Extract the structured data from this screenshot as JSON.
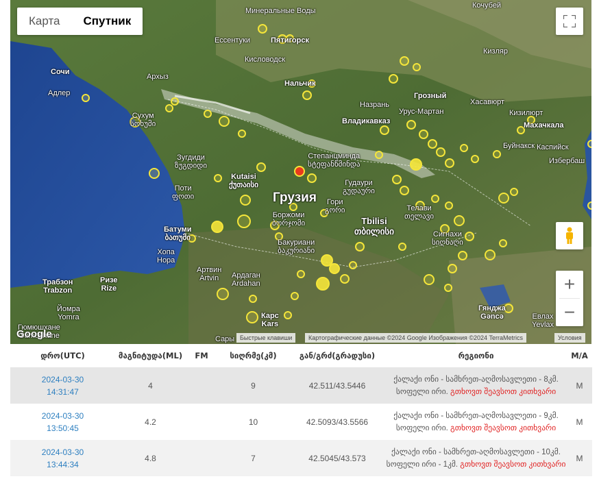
{
  "map": {
    "type_buttons": {
      "map": "Карта",
      "satellite": "Спутник"
    },
    "labels": {
      "mineralnye": "Минеральные\nВоды",
      "pyatigorsk": "Пятигорск",
      "essentuki": "Ессентуки",
      "kislovodsk": "Кисловодск",
      "kochubey": "Кочубей",
      "kizlyar": "Кизляр",
      "sochi": "Сочи",
      "adler": "Адлер",
      "arkhyz": "Архыз",
      "nalchik": "Нальчик",
      "grozny": "Грозный",
      "nazran": "Назрань",
      "urus_martan": "Урус-Мартан",
      "khasavyurt": "Хасавюрт",
      "kizilyurt": "Кизилюрт",
      "makhachkala": "Махачкала",
      "sukhum": "Сухум\nსოხუმი",
      "vladikavkaz": "Владикавказ",
      "buynaksk": "Буйнакск",
      "kaspiysk": "Каспийск",
      "izberbash": "Избербаш",
      "zugdidi": "Зугдиди\nზუგდიდი",
      "kutaisi": "Kutaisi\nქუთაისი",
      "stepantsminda": "Степанцминда\nსტეფანწმინდა",
      "gudauri": "Гудаури\nგუდაური",
      "poti": "Поти\nფოთი",
      "georgia": "Грузия",
      "gori": "Гори\nგორი",
      "borjomi": "Боржоми\nბორჯომი",
      "telavi": "Телави\nთელავი",
      "tbilisi": "Tbilisi\nთბილისი",
      "batumi": "Батуми\nბათუმი",
      "signakhi": "Сигнахи\nსიღნაღი",
      "bakuriani": "Бакуриани\nბაკურიანი",
      "khopa": "Хопа\nHopa",
      "artvin": "Артвин\nArtvin",
      "ardagan": "Ардаган\nArdahan",
      "trabzon": "Трабзон\nTrabzon",
      "rize": "Ризе\nRize",
      "yomra": "Йомра\nYomra",
      "gumushane": "Гюмюшхане\nGümüşhane",
      "kars": "Карс\nKars",
      "sary": "Сары",
      "ganja": "Гянджа\nGəncə",
      "yevlakh": "Евлах\nYevlax"
    },
    "google_logo": "Google",
    "attribution": {
      "shortcuts": "Быстрые клавиши",
      "data": "Картографические данные ©2024 Google Изображения ©2024 TerraMetrics",
      "terms": "Условия"
    },
    "zoom_in": "+",
    "zoom_out": "−"
  },
  "table": {
    "headers": {
      "date": "დრო(UTC)",
      "magnitude": "მაგნიტუდა(ML)",
      "fm": "FM",
      "depth": "სიღრმე(კმ)",
      "coords": "გან/გრძ(გრადუსი)",
      "region": "რეგიონი",
      "ma": "M/A"
    },
    "rows": [
      {
        "date": "2024-03-30",
        "time": "14:31:47",
        "magnitude": "4",
        "fm": "",
        "depth": "9",
        "coords": "42.511/43.5446",
        "region_black": "ქალაქი ონი - სამხრეთ-აღმოსავლეთი - 8კმ. სოფელი ირი. ",
        "region_red": "გთხოვთ შეავსოთ კითხვარი",
        "ma": "M"
      },
      {
        "date": "2024-03-30",
        "time": "13:50:45",
        "magnitude": "4.2",
        "fm": "",
        "depth": "10",
        "coords": "42.5093/43.5566",
        "region_black": "ქალაქი ონი - სამხრეთ-აღმოსავლეთი - 9კმ. სოფელი ირი. ",
        "region_red": "გთხოვთ შეავსოთ კითხვარი",
        "ma": "M"
      },
      {
        "date": "2024-03-30",
        "time": "13:44:34",
        "magnitude": "4.8",
        "fm": "",
        "depth": "7",
        "coords": "42.5045/43.573",
        "region_black": "ქალაქი ონი - სამხრეთ-აღმოსავლეთი - 10კმ. სოფელი ირი - 1კმ. ",
        "region_red": "გთხოვთ შეავსოთ კითხვარი",
        "ma": "M"
      }
    ]
  },
  "colors": {
    "sea": "#2a4f9c",
    "land": "#4a6b35",
    "quake_marker": "#f5e63a",
    "latest_quake": "#e83a1e",
    "date_link": "#2d7fc0",
    "region_link": "#e02020"
  }
}
